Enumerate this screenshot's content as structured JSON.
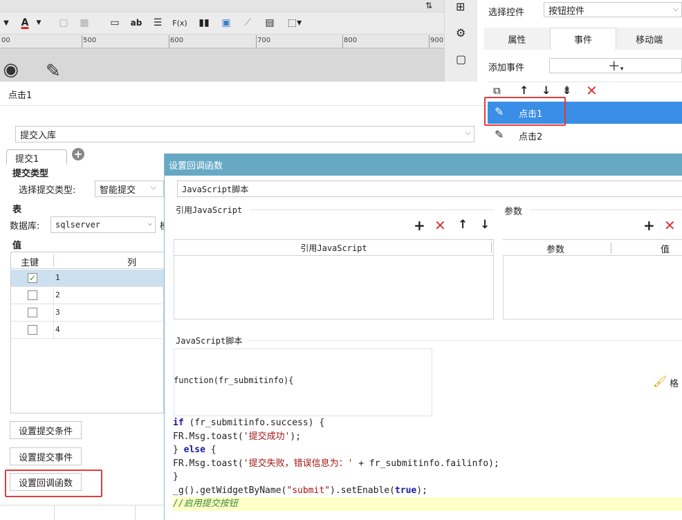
{
  "toolbar": {
    "font_color_label": "A",
    "ab_label": "ab",
    "fx_label": "F(x)",
    "ruler_marks": [
      "00",
      "500",
      "600",
      "700",
      "800",
      "900"
    ]
  },
  "right_panel": {
    "select_widget_label": "选择控件",
    "select_widget_value": "按钮控件",
    "tabs": [
      "属性",
      "事件",
      "移动端"
    ],
    "add_event_label": "添加事件",
    "events": [
      "点击1",
      "点击2"
    ]
  },
  "event_dialog": {
    "title": "点击1",
    "action_select": "提交入库",
    "submit_tab": "提交1",
    "submit_type_section": "提交类型",
    "submit_type_label": "选择提交类型:",
    "submit_type_value": "智能提交",
    "table_section": "表",
    "db_label": "数据库:",
    "db_value": "sqlserver",
    "db_trailing": "模",
    "value_section": "值",
    "columns": [
      "主键",
      "列"
    ],
    "rows": [
      {
        "checked": true,
        "col": "1"
      },
      {
        "checked": false,
        "col": "2"
      },
      {
        "checked": false,
        "col": "3"
      },
      {
        "checked": false,
        "col": "4"
      }
    ],
    "buttons": [
      "设置提交条件",
      "设置提交事件",
      "设置回调函数"
    ]
  },
  "callback_dialog": {
    "title": "设置回调函数",
    "type_value": "JavaScript脚本",
    "ref_js_section": "引用JavaScript",
    "params_section": "参数",
    "ref_js_column": "引用JavaScript",
    "params_columns": [
      "参数",
      "值"
    ],
    "script_section": "JavaScript脚本",
    "function_signature": "function(fr_submitinfo){",
    "format_label": "格",
    "code_lines": [
      "if (fr_submitinfo.success) {",
      "    FR.Msg.toast('提交成功');",
      "} else {",
      "    FR.Msg.toast('提交失败，错误信息为：' + fr_submitinfo.failinfo);",
      "}",
      "_g().getWidgetByName(\"submit\").setEnable(true);",
      "//启用提交按钮"
    ]
  },
  "colors": {
    "accent_blue": "#3a8ee6",
    "dialog_title": "#67a9c5",
    "highlight_red": "#e23a3a",
    "selected_row": "#cce0f0"
  }
}
